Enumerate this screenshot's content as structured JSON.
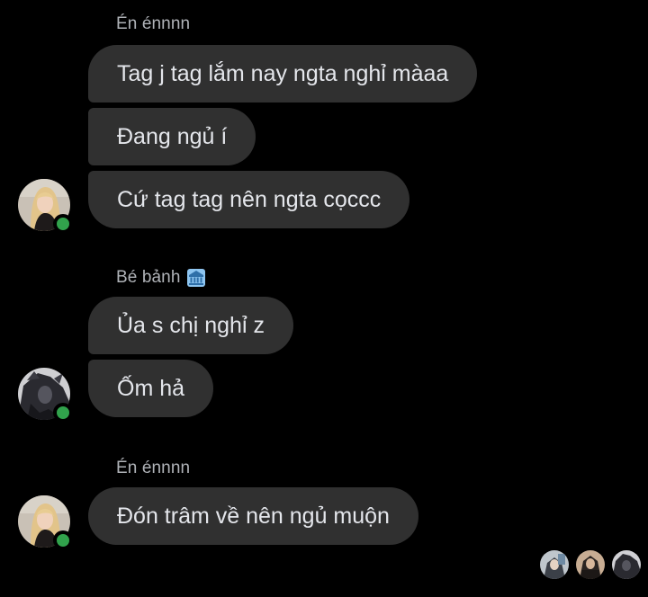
{
  "groups": [
    {
      "sender": "Én énnnn",
      "messages": [
        "Tag j tag lắm nay ngta nghỉ màaa",
        "Đang ngủ í",
        "Cứ tag tag nên ngta cọccc"
      ],
      "avatar_icon": "blonde-woman-avatar",
      "online": true
    },
    {
      "sender": "Bé bảnh",
      "sender_badge_icon": "bank-building-icon",
      "messages": [
        "Ủa s chị nghỉ z",
        "Ốm hả"
      ],
      "avatar_icon": "dark-costume-avatar",
      "online": true
    },
    {
      "sender": "Én énnnn",
      "messages": [
        "Đón trâm về nên ngủ muộn"
      ],
      "avatar_icon": "blonde-woman-avatar",
      "online": true
    }
  ],
  "seen_by": [
    "seen-avatar-1",
    "seen-avatar-2",
    "seen-avatar-3"
  ],
  "colors": {
    "background": "#000000",
    "bubble": "#303030",
    "text": "#e4e6eb",
    "sender": "#b0b3b8",
    "online": "#31a24c"
  }
}
